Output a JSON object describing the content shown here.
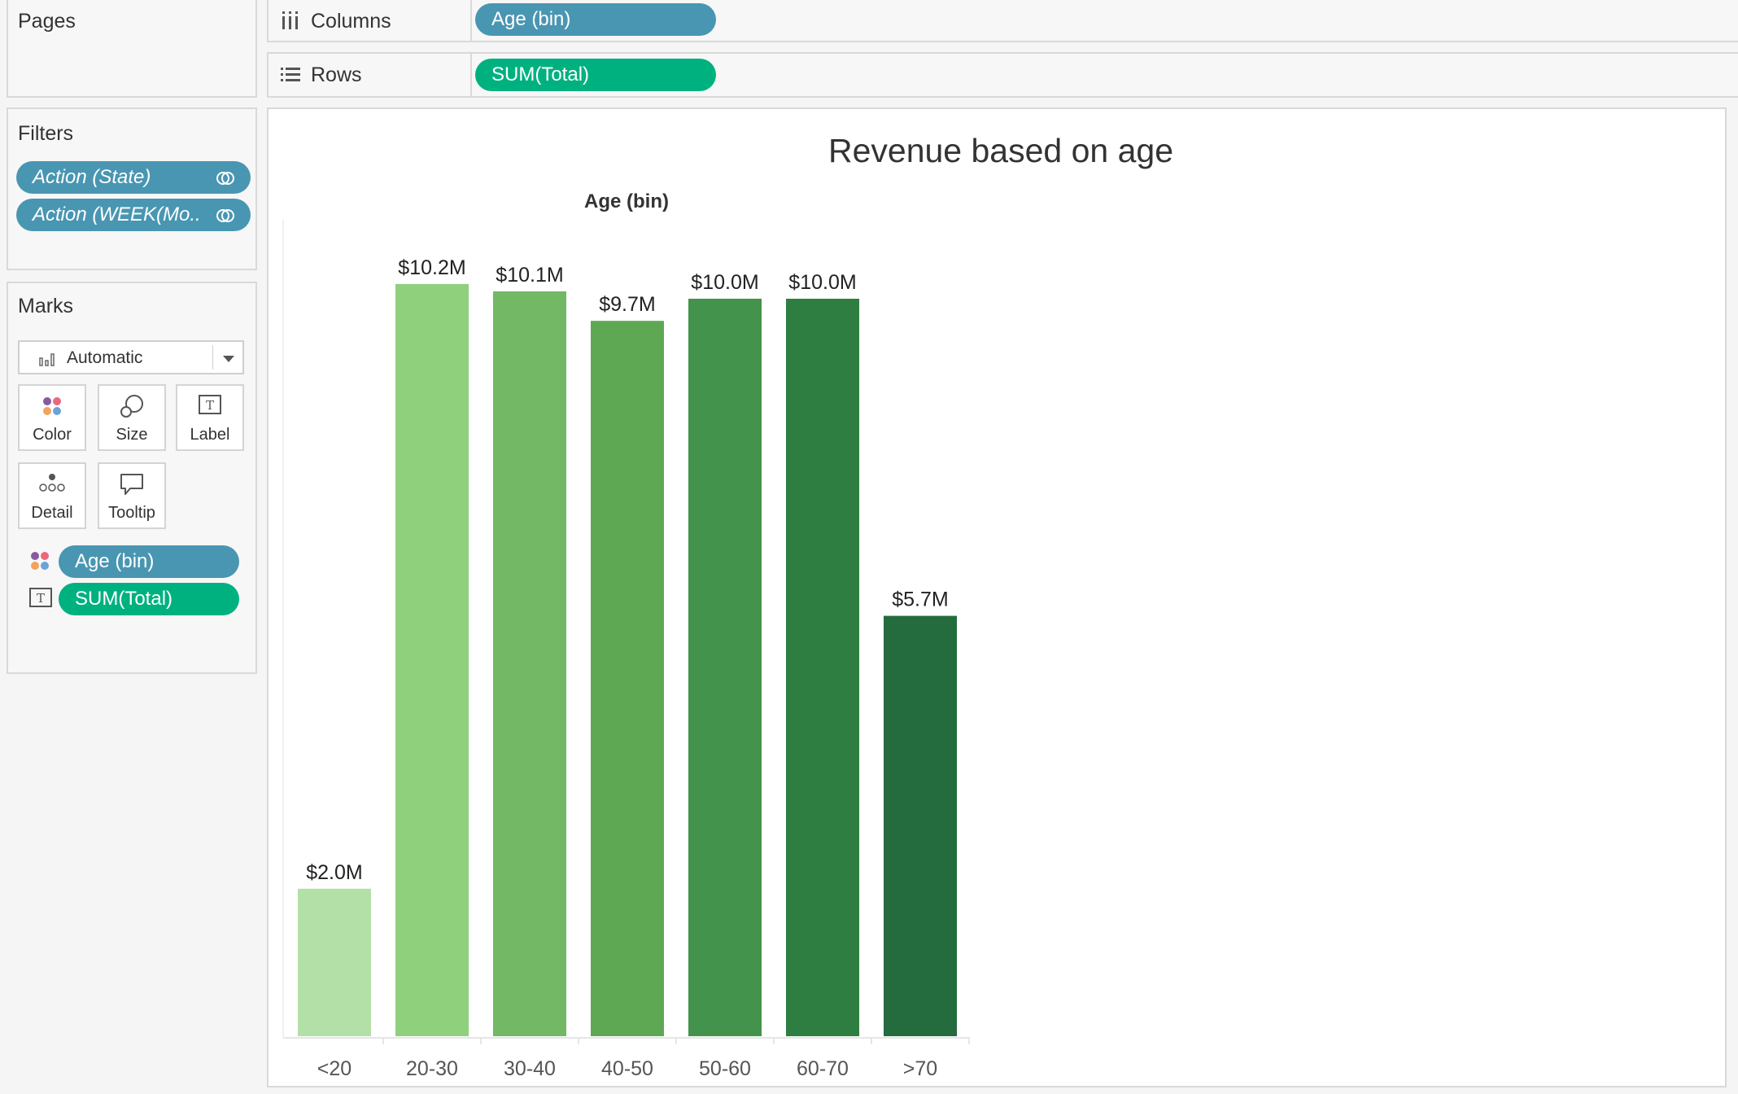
{
  "pages": {
    "title": "Pages"
  },
  "filters": {
    "title": "Filters",
    "items": [
      {
        "label": "Action (State)"
      },
      {
        "label": "Action (WEEK(Mo.."
      }
    ]
  },
  "marks": {
    "title": "Marks",
    "mark_type": "Automatic",
    "buttons": [
      {
        "label": "Color",
        "icon": "color-icon"
      },
      {
        "label": "Size",
        "icon": "size-icon"
      },
      {
        "label": "Label",
        "icon": "label-icon"
      },
      {
        "label": "Detail",
        "icon": "detail-icon"
      },
      {
        "label": "Tooltip",
        "icon": "tooltip-icon"
      }
    ],
    "fields": [
      {
        "label": "Age (bin)",
        "encoding": "color"
      },
      {
        "label": "SUM(Total)",
        "encoding": "label"
      }
    ]
  },
  "columns": {
    "label": "Columns",
    "pill": "Age (bin)"
  },
  "rows": {
    "label": "Rows",
    "pill": "SUM(Total)"
  },
  "colors": {
    "dimension_pill": "#4996b2",
    "measure_pill": "#00b180"
  },
  "chart_data": {
    "type": "bar",
    "title": "Revenue based on age",
    "column_header": "Age (bin)",
    "categories": [
      "<20",
      "20-30",
      "30-40",
      "40-50",
      "50-60",
      "60-70",
      ">70"
    ],
    "values": [
      2.0,
      10.2,
      10.1,
      9.7,
      10.0,
      10.0,
      5.7
    ],
    "value_unit": "$M",
    "labels": [
      "$2.0M",
      "$10.2M",
      "$10.1M",
      "$9.7M",
      "$10.0M",
      "$10.0M",
      "$5.7M"
    ],
    "bar_colors": [
      "#b3e0a6",
      "#8fd07d",
      "#72b865",
      "#5ea854",
      "#44934c",
      "#2e7e42",
      "#246b3d"
    ],
    "ylim": [
      0,
      11
    ],
    "grid": false,
    "legend": "none"
  }
}
